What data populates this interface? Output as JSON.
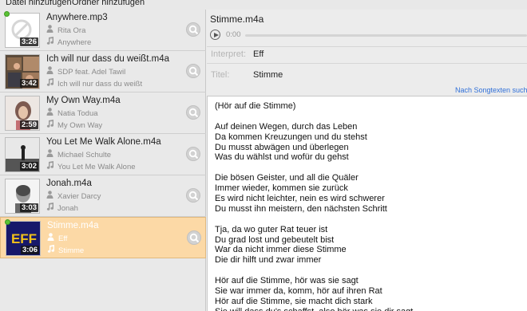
{
  "menu": {
    "add_files": "Datei hinzufügen",
    "add_folder": "Ordner hinzufügen"
  },
  "tracks": [
    {
      "title": "Anywhere.mp3",
      "artist": "Rita Ora",
      "album": "Anywhere",
      "duration": "3:26",
      "art": "placeholder",
      "badge": true
    },
    {
      "title": "Ich will nur dass du weißt.m4a",
      "artist": "SDP feat. Adel Tawil",
      "album": "Ich will nur dass du weißt",
      "duration": "3:42",
      "art": "collage"
    },
    {
      "title": "My Own Way.m4a",
      "artist": "Natia Todua",
      "album": "My Own Way",
      "duration": "2:59",
      "art": "portrait-light"
    },
    {
      "title": "You Let Me Walk Alone.m4a",
      "artist": "Michael Schulte",
      "album": "You Let Me Walk Alone",
      "duration": "3:02",
      "art": "bw-photo"
    },
    {
      "title": "Jonah.m4a",
      "artist": "Xavier Darcy",
      "album": "Jonah",
      "duration": "3:03",
      "art": "bw-portrait"
    },
    {
      "title": "Stimme.m4a",
      "artist": "Eff",
      "album": "Stimme",
      "duration": "3:06",
      "art": "eff-logo",
      "badge": true,
      "selected": true
    }
  ],
  "icons": {
    "artist": "person-icon",
    "album": "music-note-icon",
    "search": "search-icon",
    "play": "play-icon",
    "now_playing": "green-dot-icon"
  },
  "colors": {
    "selected_bg": "#fcd9a6",
    "link": "#2f6fd8",
    "badge": "#5bc236"
  },
  "player": {
    "filename": "Stimme.m4a",
    "time": "0:00",
    "progress": 0
  },
  "details": {
    "artist_label": "Interpret:",
    "artist_value": "Eff",
    "title_label": "Titel:",
    "title_value": "Stimme",
    "search_link": "Nach Songtexten such"
  },
  "lyrics": [
    "(Hör auf die Stimme)",
    "",
    "Auf deinen Wegen, durch das Leben",
    "Da kommen Kreuzungen und du stehst",
    "Du musst abwägen und überlegen",
    "Was du wählst und wofür du gehst",
    "",
    "Die bösen Geister, und all die Quäler",
    "Immer wieder, kommen sie zurück",
    "Es wird nicht leichter, nein es wird schwerer",
    "Du musst ihn meistern, den nächsten Schritt",
    "",
    "Tja, da wo guter Rat teuer ist",
    "Du grad lost und gebeutelt bist",
    "War da nicht immer diese Stimme",
    "Die dir hilft und zwar immer",
    "",
    "Hör auf die Stimme, hör was sie sagt",
    "Sie war immer da, komm, hör auf ihren Rat",
    "Hör auf die Stimme, sie macht dich stark",
    "Sie will dass du's schaffst, also hör was sie dir sagt"
  ]
}
